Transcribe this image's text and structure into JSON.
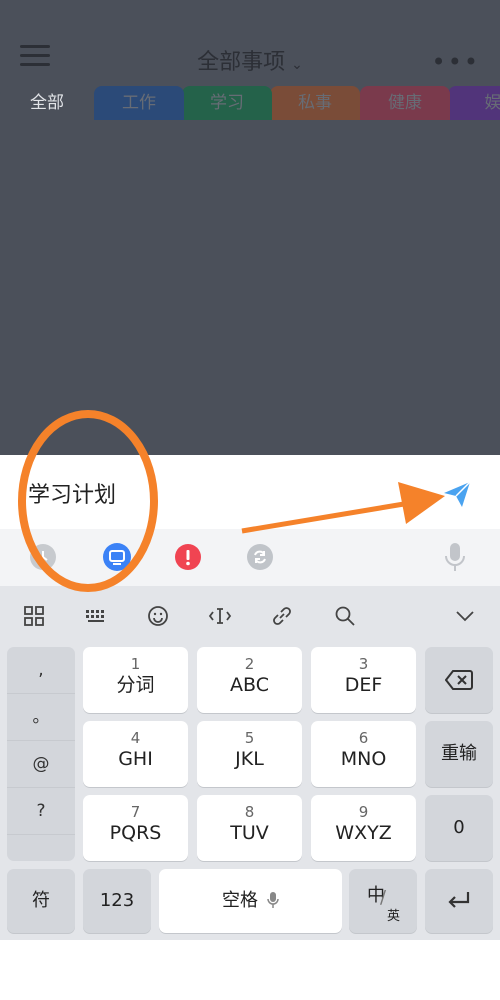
{
  "header": {
    "title": "全部事项",
    "title_dropdown_icon": "chevron-down-icon",
    "menu_icon": "hamburger-menu-icon",
    "more_icon": "more-horizontal-icon"
  },
  "tabs": [
    {
      "label": "全部"
    },
    {
      "label": "工作"
    },
    {
      "label": "学习"
    },
    {
      "label": "私事"
    },
    {
      "label": "健康"
    },
    {
      "label": "娱"
    }
  ],
  "task_input": {
    "value": "学习计划"
  },
  "options": [
    {
      "icon": "clock-icon"
    },
    {
      "icon": "category-icon"
    },
    {
      "icon": "priority-icon"
    },
    {
      "icon": "repeat-icon"
    },
    {
      "icon": "microphone-icon"
    }
  ],
  "keyboard": {
    "toolbar": [
      "grid-icon",
      "keyboard-icon",
      "emoji-icon",
      "cursor-icon",
      "link-icon",
      "search-icon",
      "collapse-chevron-icon"
    ],
    "symbols": [
      ",",
      "。",
      "@",
      "?"
    ],
    "rows": [
      [
        {
          "num": "1",
          "label": "分词"
        },
        {
          "num": "2",
          "label": "ABC"
        },
        {
          "num": "3",
          "label": "DEF"
        }
      ],
      [
        {
          "num": "4",
          "label": "GHI"
        },
        {
          "num": "5",
          "label": "JKL"
        },
        {
          "num": "6",
          "label": "MNO"
        }
      ],
      [
        {
          "num": "7",
          "label": "PQRS"
        },
        {
          "num": "8",
          "label": "TUV"
        },
        {
          "num": "9",
          "label": "WXYZ"
        }
      ]
    ],
    "reinput": "重输",
    "zero": "0",
    "fu": "符",
    "num_toggle": "123",
    "space": "空格",
    "lang_cn": "中",
    "lang_en": "英"
  },
  "colors": {
    "accent_blue": "#3b82f6",
    "annotation_orange": "#f5822a"
  }
}
